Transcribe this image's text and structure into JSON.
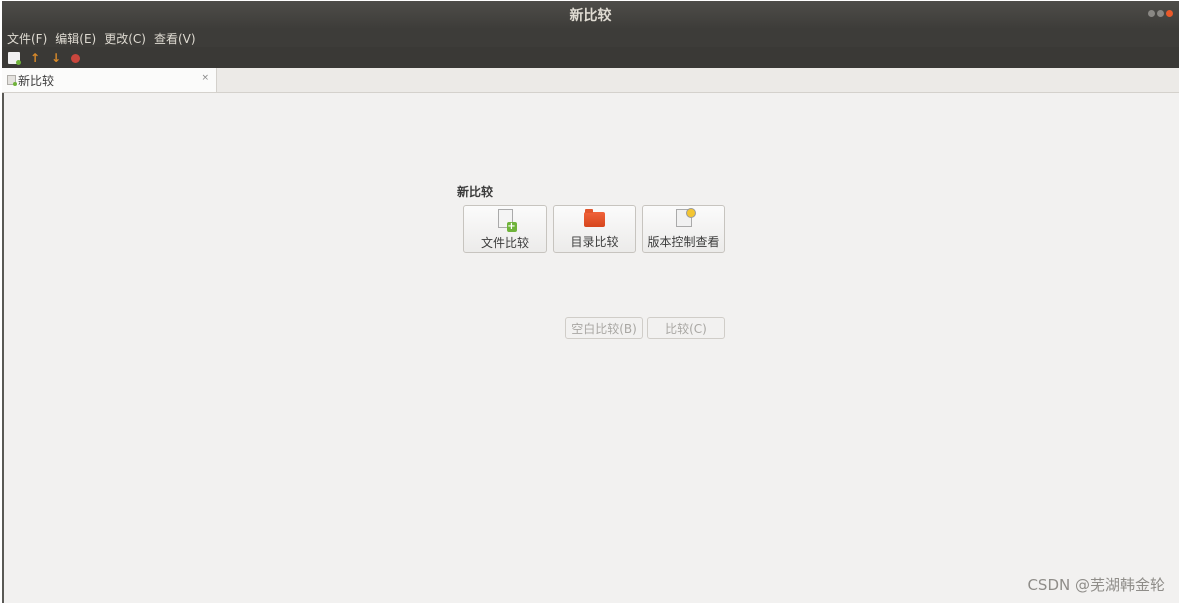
{
  "window": {
    "title": "新比较"
  },
  "menubar": {
    "items": [
      {
        "label": "文件(F)"
      },
      {
        "label": "编辑(E)"
      },
      {
        "label": "更改(C)"
      },
      {
        "label": "查看(V)"
      }
    ]
  },
  "toolbar": {
    "icons": [
      "new-comparison-icon",
      "arrow-up-icon",
      "arrow-down-icon",
      "stop-icon"
    ]
  },
  "tabs": [
    {
      "label": "新比较",
      "close_label": "×"
    }
  ],
  "main": {
    "section_title": "新比较",
    "buttons": [
      {
        "label": "文件比较",
        "icon": "file-compare-icon"
      },
      {
        "label": "目录比较",
        "icon": "folder-compare-icon"
      },
      {
        "label": "版本控制查看",
        "icon": "version-control-icon"
      }
    ],
    "actions": [
      {
        "label": "空白比较(B)"
      },
      {
        "label": "比较(C)"
      }
    ]
  },
  "watermark": "CSDN @芜湖韩金轮",
  "colors": {
    "titlebar": "#3d3c39",
    "accent_close": "#e9592a",
    "background": "#f2f1f0"
  }
}
